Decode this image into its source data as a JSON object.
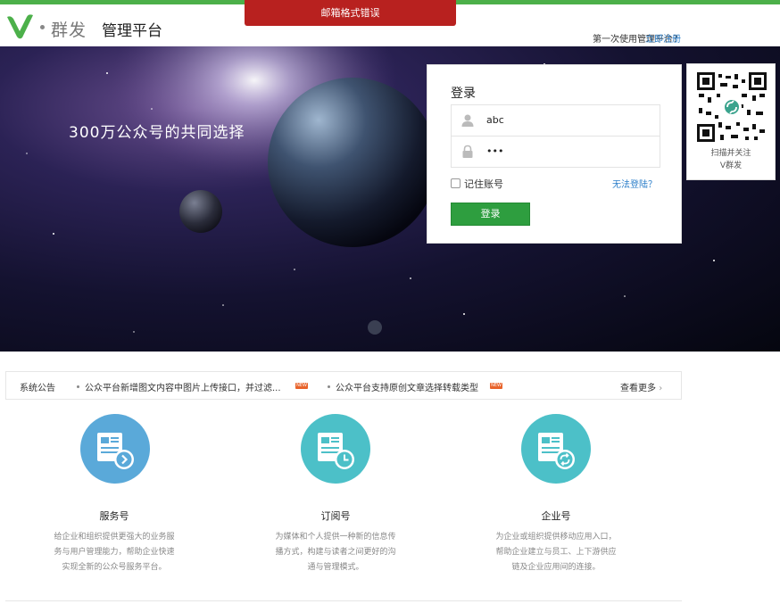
{
  "header": {
    "brand": "群发",
    "platform": "管理平台",
    "first_use_text": "第一次使用管理平台？",
    "register_link": "立即注册"
  },
  "error_message": "邮箱格式错误",
  "banner": {
    "slogan": "300万公众号的共同选择"
  },
  "login": {
    "title": "登录",
    "username_value": "abc",
    "password_value": "•••",
    "remember_label": "记住账号",
    "forgot_link": "无法登陆？",
    "submit_label": "登录"
  },
  "qr": {
    "line1": "扫描并关注",
    "line2": "V群发"
  },
  "notices": {
    "label": "系统公告",
    "items": [
      {
        "text": "公众平台新增图文内容中图片上传接口，并过滤..."
      },
      {
        "text": "公众平台支持原创文章选择转载类型"
      }
    ],
    "badge": "NEW",
    "more_label": "查看更多"
  },
  "cards": [
    {
      "title": "服务号",
      "lines": [
        "给企业和组织提供更强大的业务服",
        "务与用户管理能力，帮助企业快速",
        "实现全新的公众号服务平台。"
      ]
    },
    {
      "title": "订阅号",
      "lines": [
        "为媒体和个人提供一种新的信息传",
        "播方式，构建与读者之间更好的沟",
        "通与管理模式。"
      ]
    },
    {
      "title": "企业号",
      "lines": [
        "为企业或组织提供移动应用入口，",
        "帮助企业建立与员工、上下游供应",
        "链及企业应用间的连接。"
      ]
    }
  ],
  "colors": {
    "brand_green": "#4cb04a",
    "error_red": "#b8211f",
    "login_green": "#2e9e3f",
    "link_blue": "#2b7ec9",
    "icon_blue": "#5aa9d9",
    "icon_teal": "#4cc0c8"
  }
}
